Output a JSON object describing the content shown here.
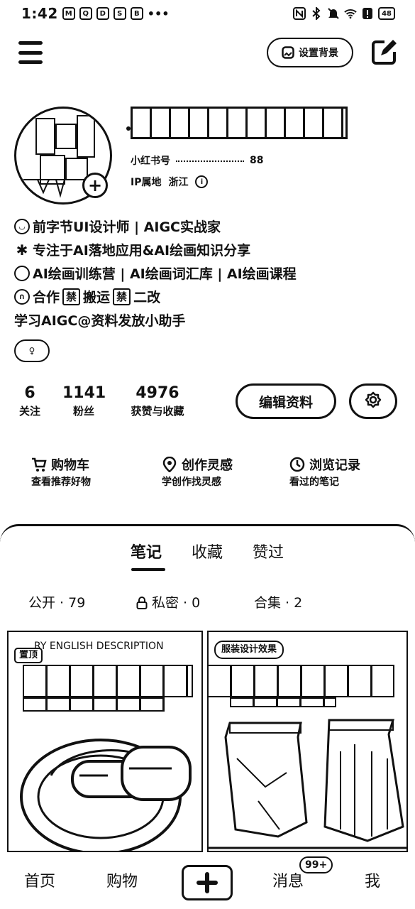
{
  "status_bar": {
    "time": "1:42",
    "notifications": [
      "M",
      "Q",
      "D",
      "S",
      "B"
    ],
    "more": "•••",
    "battery": "48"
  },
  "header": {
    "menu_icon": "hamburger-menu-icon",
    "set_background_label": "设置背景",
    "share_icon": "edit-share-icon"
  },
  "profile": {
    "id_label": "小红书号",
    "id_suffix": "88",
    "ip_label": "IP属地",
    "ip_value": "浙江",
    "bio": [
      {
        "icon": "smile-icon",
        "text": "前字节UI设计师 | AIGC实战家"
      },
      {
        "icon": "sparkle-icon",
        "text": "专注于AI落地应用&AI绘画知识分享"
      },
      {
        "icon": "dot-icon",
        "text": "AI绘画训练营 | AI绘画词汇库 |  AI绘画课程"
      },
      {
        "icon": "handshake-icon",
        "text_a": "合作",
        "chip_a": "禁",
        "text_b": "搬运",
        "chip_b": "禁",
        "text_c": "二改"
      },
      {
        "text": "学习AIGC@资料发放小助手"
      }
    ],
    "gender_symbol": "♀"
  },
  "stats": [
    {
      "value": "6",
      "label": "关注"
    },
    {
      "value": "1141",
      "label": "粉丝"
    },
    {
      "value": "4976",
      "label": "获赞与收藏"
    }
  ],
  "actions": {
    "edit_profile": "编辑资料"
  },
  "shortcuts": [
    {
      "title": "购物车",
      "subtitle": "查看推荐好物"
    },
    {
      "title": "创作灵感",
      "subtitle": "学创作找灵感"
    },
    {
      "title": "浏览记录",
      "subtitle": "看过的笔记"
    }
  ],
  "tabs": [
    "笔记",
    "收藏",
    "赞过"
  ],
  "filters": [
    {
      "label": "公开 · 79"
    },
    {
      "label": "私密 · 0"
    },
    {
      "label": "合集 · 2"
    }
  ],
  "cards": [
    {
      "badge": "置顶",
      "caption": "RY ENGLISH DESCRIPTION"
    },
    {
      "chip": "服装设计效果"
    }
  ],
  "bottom_nav": {
    "home": "首页",
    "shop": "购物",
    "messages": "消息",
    "messages_badge": "99+",
    "me": "我"
  }
}
